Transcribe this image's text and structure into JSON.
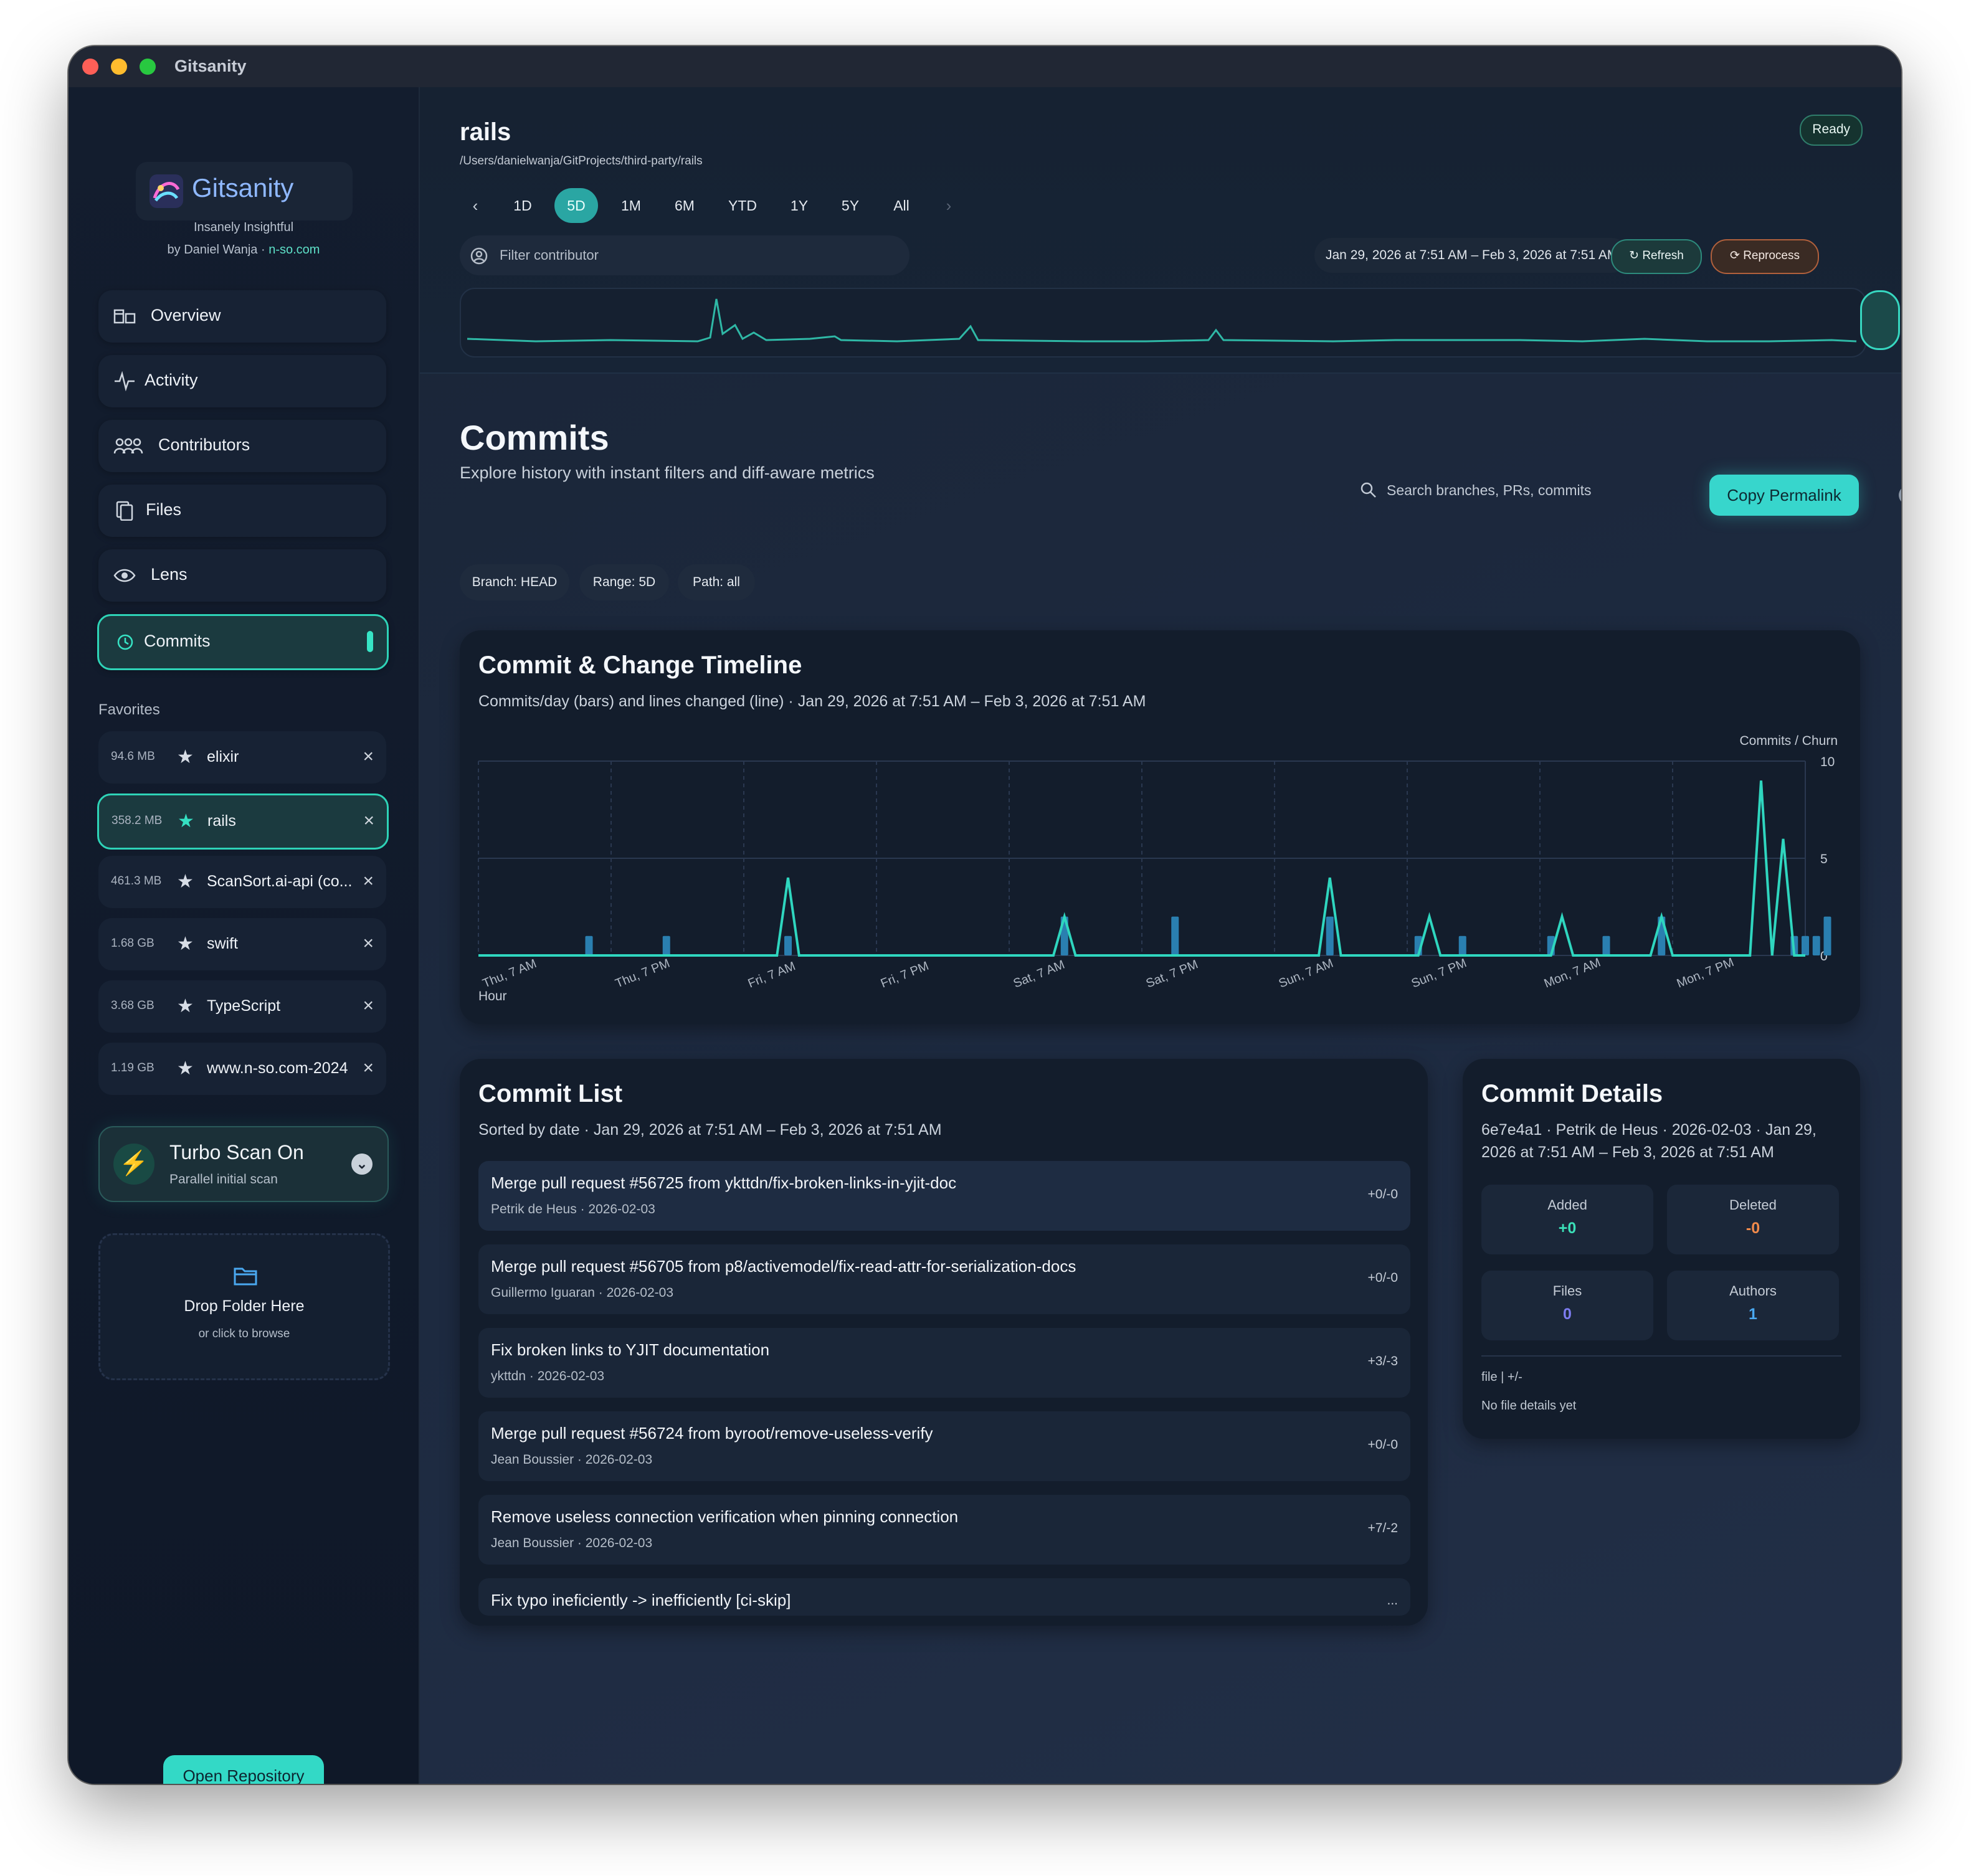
{
  "window": {
    "title": "Gitsanity"
  },
  "sidebar": {
    "app_name": "Gitsanity",
    "tagline": "Insanely Insightful",
    "author_prefix": "by Daniel Wanja ·",
    "author_link": "n-so.com",
    "nav": [
      {
        "label": "Overview",
        "icon": "overview-icon"
      },
      {
        "label": "Activity",
        "icon": "activity-icon"
      },
      {
        "label": "Contributors",
        "icon": "contributors-icon"
      },
      {
        "label": "Files",
        "icon": "files-icon"
      },
      {
        "label": "Lens",
        "icon": "eye-icon"
      },
      {
        "label": "Commits",
        "icon": "history-icon",
        "active": true
      }
    ],
    "favorites_heading": "Favorites",
    "favorites": [
      {
        "size": "94.6 MB",
        "name": "elixir"
      },
      {
        "size": "358.2 MB",
        "name": "rails",
        "active": true
      },
      {
        "size": "461.3 MB",
        "name": "ScanSort.ai-api (co..."
      },
      {
        "size": "1.68 GB",
        "name": "swift"
      },
      {
        "size": "3.68 GB",
        "name": "TypeScript"
      },
      {
        "size": "1.19 GB",
        "name": "www.n-so.com-2024"
      }
    ],
    "turbo": {
      "title": "Turbo Scan On",
      "subtitle": "Parallel initial scan"
    },
    "drop": {
      "title": "Drop Folder Here",
      "subtitle": "or click to browse"
    },
    "open_button": "Open Repository"
  },
  "header": {
    "repo_name": "rails",
    "repo_path": "/Users/danielwanja/GitProjects/third-party/rails",
    "status": "Ready",
    "ranges": [
      "1D",
      "5D",
      "1M",
      "6M",
      "YTD",
      "1Y",
      "5Y",
      "All"
    ],
    "active_range": "5D",
    "filter_placeholder": "Filter contributor",
    "date_range": "Jan 29, 2026 at 7:51 AM – Feb 3, 2026 at 7:51 AM",
    "refresh_label": "Refresh",
    "reprocess_label": "Reprocess"
  },
  "page": {
    "title": "Commits",
    "subtitle": "Explore history with instant filters and diff-aware metrics",
    "search_placeholder": "Search branches, PRs, commits",
    "copy_label": "Copy Permalink",
    "help": "?",
    "chips": [
      "Branch: HEAD",
      "Range: 5D",
      "Path: all"
    ]
  },
  "timeline": {
    "title": "Commit & Change Timeline",
    "subtitle": "Commits/day (bars) and lines changed (line) · Jan 29, 2026 at 7:51 AM – Feb 3, 2026 at 7:51 AM",
    "axis_caption": "Commits / Churn",
    "x_label": "Hour"
  },
  "chart_data": {
    "type": "bar",
    "title": "Commit & Change Timeline",
    "xlabel": "Hour",
    "ylabel": "Commits / Churn",
    "ylim": [
      0,
      10
    ],
    "yticks": [
      0,
      5,
      10
    ],
    "x_ticks": [
      "Thu, 7 AM",
      "Thu, 7 PM",
      "Fri, 7 AM",
      "Fri, 7 PM",
      "Sat, 7 AM",
      "Sat, 7 PM",
      "Sun, 7 AM",
      "Sun, 7 PM",
      "Mon, 7 AM",
      "Mon, 7 PM"
    ],
    "x_range_hours": [
      0,
      120
    ],
    "series": [
      {
        "kind": "bars",
        "x": [
          10,
          17,
          28,
          53,
          63,
          77,
          85,
          89,
          97,
          102,
          107,
          119,
          120,
          121,
          122
        ],
        "values": [
          1,
          1,
          1,
          2,
          2,
          2,
          1,
          1,
          1,
          1,
          2,
          1,
          1,
          1,
          2
        ]
      },
      {
        "kind": "line",
        "x": [
          0,
          27,
          28,
          29,
          52,
          53,
          54,
          76,
          77,
          78,
          85,
          86,
          87,
          97,
          98,
          99,
          106,
          107,
          108,
          115,
          116,
          117,
          118,
          119,
          120
        ],
        "values": [
          0,
          0,
          4,
          0,
          0,
          2,
          0,
          0,
          4,
          0,
          0,
          2,
          0,
          0,
          2,
          0,
          0,
          2,
          0,
          0,
          9,
          0,
          6,
          0,
          0
        ]
      }
    ]
  },
  "commit_list": {
    "title": "Commit List",
    "subtitle": "Sorted by date · Jan 29, 2026 at 7:51 AM – Feb 3, 2026 at 7:51 AM",
    "rows": [
      {
        "message": "Merge pull request #56725 from ykttdn/fix-broken-links-in-yjit-doc",
        "author": "Petrik de Heus · 2026-02-03",
        "diff": "+0/-0"
      },
      {
        "message": "Merge pull request #56705 from p8/activemodel/fix-read-attr-for-serialization-docs",
        "author": "Guillermo Iguaran · 2026-02-03",
        "diff": "+0/-0"
      },
      {
        "message": "Fix broken links to YJIT documentation",
        "author": "ykttdn · 2026-02-03",
        "diff": "+3/-3"
      },
      {
        "message": "Merge pull request #56724 from byroot/remove-useless-verify",
        "author": "Jean Boussier · 2026-02-03",
        "diff": "+0/-0"
      },
      {
        "message": "Remove useless connection verification when pinning connection",
        "author": "Jean Boussier · 2026-02-03",
        "diff": "+7/-2"
      },
      {
        "message": "Fix typo ineficiently -> inefficiently [ci-skip]",
        "author": "",
        "diff": "..."
      }
    ]
  },
  "commit_details": {
    "title": "Commit Details",
    "subtitle": "6e7e4a1 · Petrik de Heus · 2026-02-03 · Jan 29, 2026 at 7:51 AM – Feb 3, 2026 at 7:51 AM",
    "stats": [
      {
        "label": "Added",
        "value": "+0",
        "color": "#3be0b8"
      },
      {
        "label": "Deleted",
        "value": "-0",
        "color": "#f08a4b"
      },
      {
        "label": "Files",
        "value": "0",
        "color": "#7d7cf0"
      },
      {
        "label": "Authors",
        "value": "1",
        "color": "#4aa8f0"
      }
    ],
    "file_header": "file | +/-",
    "empty_text": "No file details yet"
  },
  "colors": {
    "accent": "#2ed3b7",
    "bars": "#2a7fb0",
    "line": "#2fd6bf"
  }
}
